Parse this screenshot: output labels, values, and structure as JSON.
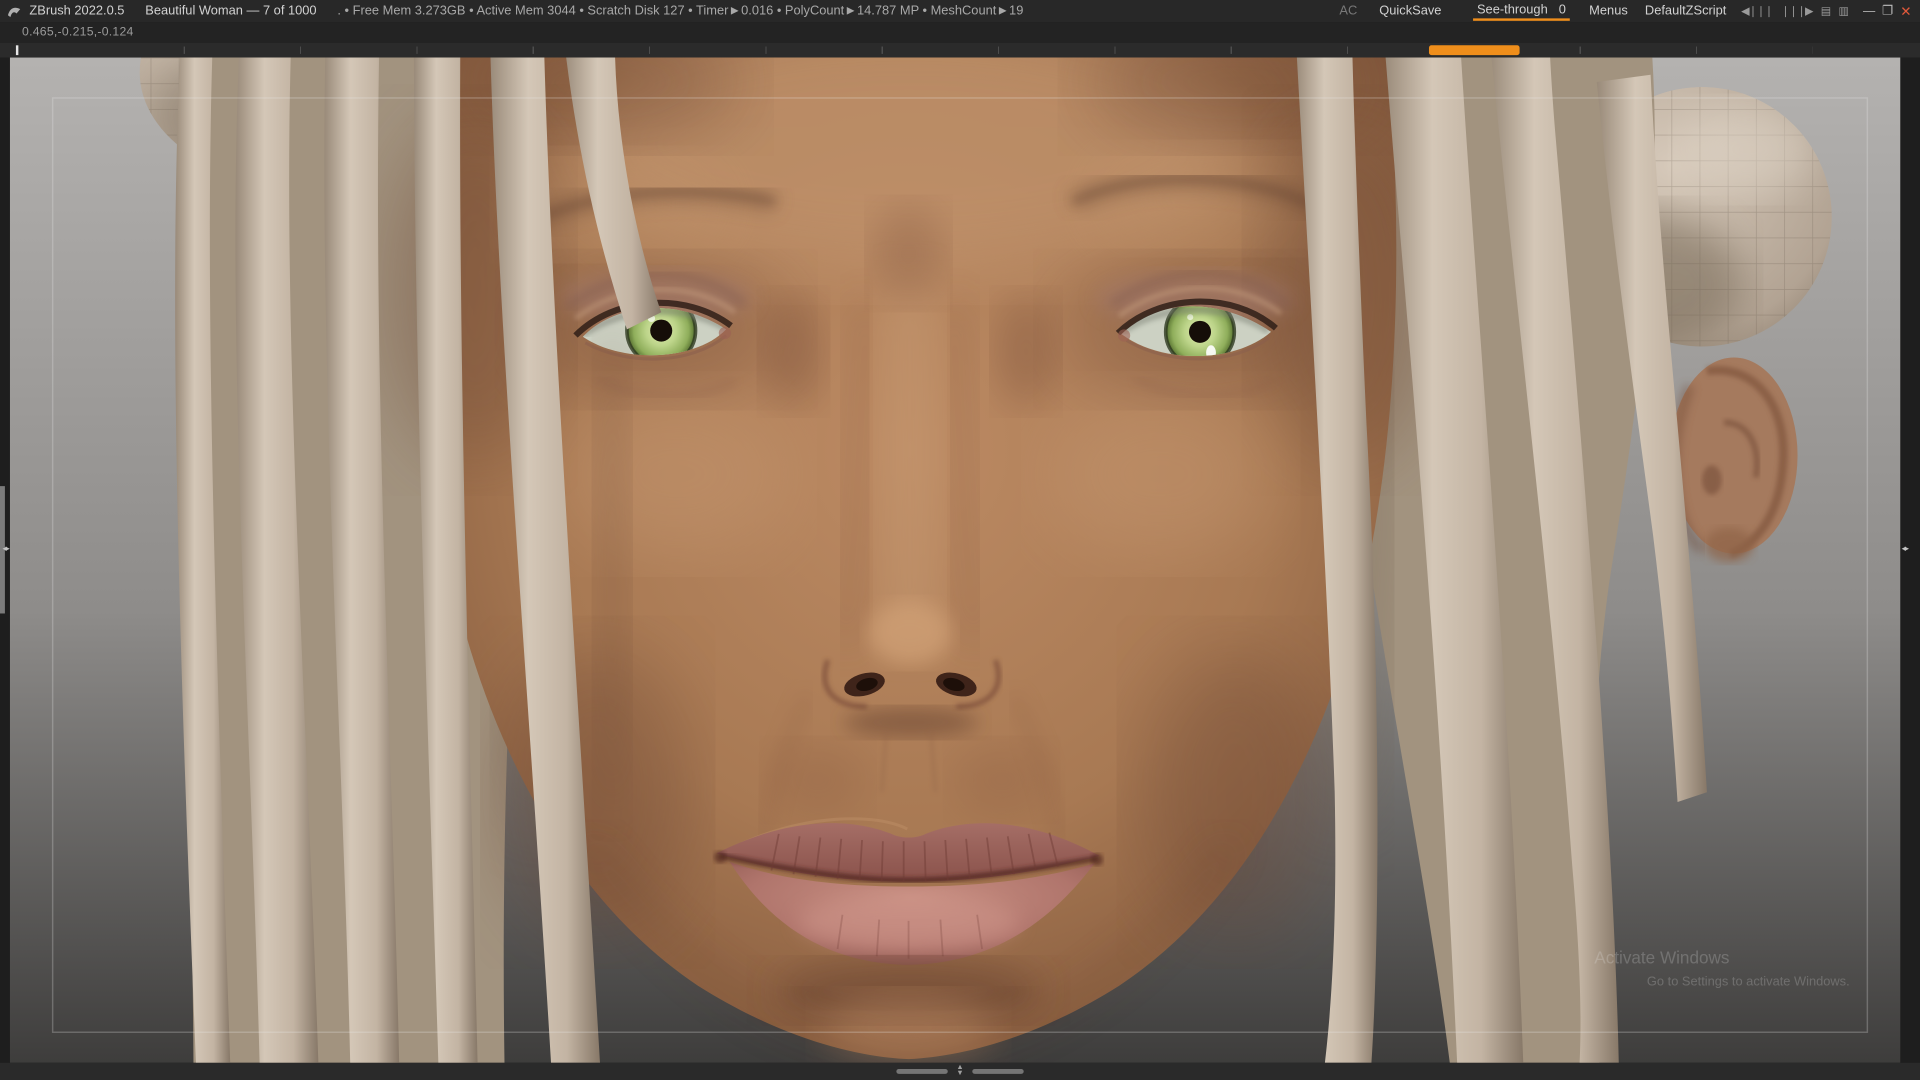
{
  "colors": {
    "root_bg": "#1e1e1e",
    "titlebar_bg": "#282828",
    "panel_bg": "#232323",
    "shelf_bg": "#2b2b2b",
    "bottombar_bg": "#2a2a2a",
    "accent_orange": "#ef8e1b",
    "close_red": "#e2593a",
    "text_light": "#cfcfcf",
    "canvas_top": "#b4b2b0",
    "canvas_bottom": "#434241",
    "skin_mid": "#a87953",
    "hair_beige": "#cfc1b1",
    "eye_green": "#bcd489",
    "lip_rose": "#b0756c"
  },
  "titlebar": {
    "app_title": "ZBrush 2022.0.5",
    "document_title": "Beautiful Woman — 7 of 1000",
    "stats": ". • Free Mem 3.273GB • Active Mem 3044 • Scratch Disk 127 •  Timer►0.016 • PolyCount►14.787 MP  • MeshCount►19",
    "ac_label": "AC",
    "quicksave_label": "QuickSave",
    "see_through_label": "See-through",
    "see_through_value": "0",
    "menus_label": "Menus",
    "zscript_label": "DefaultZScript",
    "minimize_glyph": "—",
    "maximize_glyph": "❐",
    "close_glyph": "✕"
  },
  "icons": {
    "dock_left": "◀❘❘❘",
    "dock_right": "❘❘❘▶",
    "panel_a": "▤",
    "panel_b": "▥",
    "tray_arrow": "◂▸",
    "scroll_up": "▲",
    "scroll_down": "▼"
  },
  "viewbar": {
    "coordinates": "0.465,-0.215,-0.124"
  },
  "canvas": {
    "watermark_line1": "Activate Windows",
    "watermark_line2": "Go to Settings to activate Windows."
  }
}
